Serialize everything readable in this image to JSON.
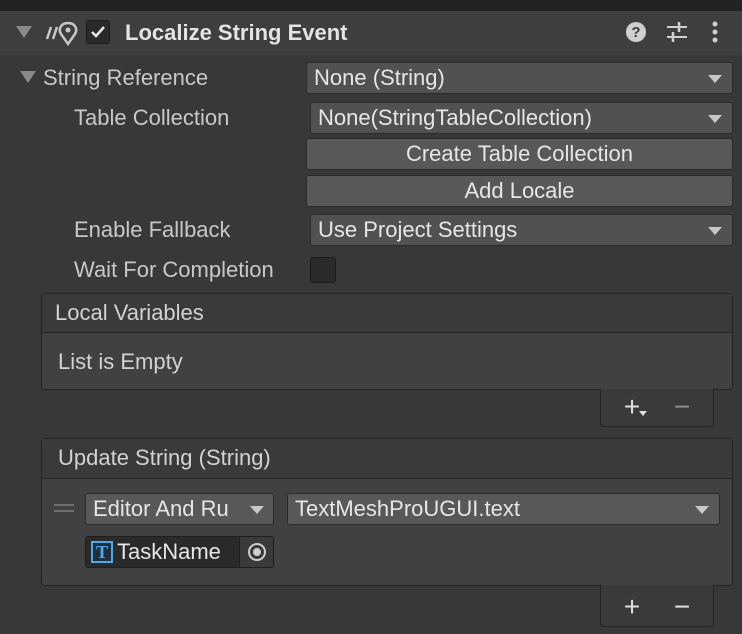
{
  "component": {
    "title": "Localize String Event",
    "enabled": true
  },
  "string_reference": {
    "label": "String Reference",
    "value": "None (String)"
  },
  "table_collection": {
    "label": "Table Collection",
    "value": "None(StringTableCollection)"
  },
  "buttons": {
    "create_table_collection": "Create Table Collection",
    "add_locale": "Add Locale"
  },
  "enable_fallback": {
    "label": "Enable Fallback",
    "value": "Use Project Settings"
  },
  "wait_for_completion": {
    "label": "Wait For Completion",
    "checked": false
  },
  "local_variables": {
    "header": "Local Variables",
    "empty_text": "List is Empty",
    "add_symbol": "+",
    "remove_symbol": "−"
  },
  "update_string": {
    "header": "Update String (String)",
    "runtime_mode": "Editor And Ru",
    "function": "TextMeshProUGUI.text",
    "target_object": "TaskName",
    "target_icon_glyph": "T",
    "add_symbol": "+",
    "remove_symbol": "−"
  },
  "icons": [
    "fold-arrow-icon",
    "localization-icon",
    "checkmark-icon",
    "help-icon",
    "presets-icon",
    "kebab-menu-icon",
    "caret-down-icon",
    "object-picker-icon",
    "drag-handle-icon"
  ]
}
